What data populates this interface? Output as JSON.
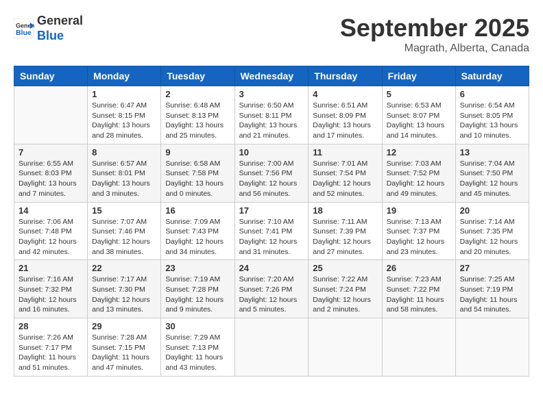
{
  "header": {
    "logo_line1": "General",
    "logo_line2": "Blue",
    "month": "September 2025",
    "location": "Magrath, Alberta, Canada"
  },
  "weekdays": [
    "Sunday",
    "Monday",
    "Tuesday",
    "Wednesday",
    "Thursday",
    "Friday",
    "Saturday"
  ],
  "weeks": [
    [
      {
        "day": "",
        "info": ""
      },
      {
        "day": "1",
        "info": "Sunrise: 6:47 AM\nSunset: 8:15 PM\nDaylight: 13 hours\nand 28 minutes."
      },
      {
        "day": "2",
        "info": "Sunrise: 6:48 AM\nSunset: 8:13 PM\nDaylight: 13 hours\nand 25 minutes."
      },
      {
        "day": "3",
        "info": "Sunrise: 6:50 AM\nSunset: 8:11 PM\nDaylight: 13 hours\nand 21 minutes."
      },
      {
        "day": "4",
        "info": "Sunrise: 6:51 AM\nSunset: 8:09 PM\nDaylight: 13 hours\nand 17 minutes."
      },
      {
        "day": "5",
        "info": "Sunrise: 6:53 AM\nSunset: 8:07 PM\nDaylight: 13 hours\nand 14 minutes."
      },
      {
        "day": "6",
        "info": "Sunrise: 6:54 AM\nSunset: 8:05 PM\nDaylight: 13 hours\nand 10 minutes."
      }
    ],
    [
      {
        "day": "7",
        "info": "Sunrise: 6:55 AM\nSunset: 8:03 PM\nDaylight: 13 hours\nand 7 minutes."
      },
      {
        "day": "8",
        "info": "Sunrise: 6:57 AM\nSunset: 8:01 PM\nDaylight: 13 hours\nand 3 minutes."
      },
      {
        "day": "9",
        "info": "Sunrise: 6:58 AM\nSunset: 7:58 PM\nDaylight: 13 hours\nand 0 minutes."
      },
      {
        "day": "10",
        "info": "Sunrise: 7:00 AM\nSunset: 7:56 PM\nDaylight: 12 hours\nand 56 minutes."
      },
      {
        "day": "11",
        "info": "Sunrise: 7:01 AM\nSunset: 7:54 PM\nDaylight: 12 hours\nand 52 minutes."
      },
      {
        "day": "12",
        "info": "Sunrise: 7:03 AM\nSunset: 7:52 PM\nDaylight: 12 hours\nand 49 minutes."
      },
      {
        "day": "13",
        "info": "Sunrise: 7:04 AM\nSunset: 7:50 PM\nDaylight: 12 hours\nand 45 minutes."
      }
    ],
    [
      {
        "day": "14",
        "info": "Sunrise: 7:06 AM\nSunset: 7:48 PM\nDaylight: 12 hours\nand 42 minutes."
      },
      {
        "day": "15",
        "info": "Sunrise: 7:07 AM\nSunset: 7:46 PM\nDaylight: 12 hours\nand 38 minutes."
      },
      {
        "day": "16",
        "info": "Sunrise: 7:09 AM\nSunset: 7:43 PM\nDaylight: 12 hours\nand 34 minutes."
      },
      {
        "day": "17",
        "info": "Sunrise: 7:10 AM\nSunset: 7:41 PM\nDaylight: 12 hours\nand 31 minutes."
      },
      {
        "day": "18",
        "info": "Sunrise: 7:11 AM\nSunset: 7:39 PM\nDaylight: 12 hours\nand 27 minutes."
      },
      {
        "day": "19",
        "info": "Sunrise: 7:13 AM\nSunset: 7:37 PM\nDaylight: 12 hours\nand 23 minutes."
      },
      {
        "day": "20",
        "info": "Sunrise: 7:14 AM\nSunset: 7:35 PM\nDaylight: 12 hours\nand 20 minutes."
      }
    ],
    [
      {
        "day": "21",
        "info": "Sunrise: 7:16 AM\nSunset: 7:32 PM\nDaylight: 12 hours\nand 16 minutes."
      },
      {
        "day": "22",
        "info": "Sunrise: 7:17 AM\nSunset: 7:30 PM\nDaylight: 12 hours\nand 13 minutes."
      },
      {
        "day": "23",
        "info": "Sunrise: 7:19 AM\nSunset: 7:28 PM\nDaylight: 12 hours\nand 9 minutes."
      },
      {
        "day": "24",
        "info": "Sunrise: 7:20 AM\nSunset: 7:26 PM\nDaylight: 12 hours\nand 5 minutes."
      },
      {
        "day": "25",
        "info": "Sunrise: 7:22 AM\nSunset: 7:24 PM\nDaylight: 12 hours\nand 2 minutes."
      },
      {
        "day": "26",
        "info": "Sunrise: 7:23 AM\nSunset: 7:22 PM\nDaylight: 11 hours\nand 58 minutes."
      },
      {
        "day": "27",
        "info": "Sunrise: 7:25 AM\nSunset: 7:19 PM\nDaylight: 11 hours\nand 54 minutes."
      }
    ],
    [
      {
        "day": "28",
        "info": "Sunrise: 7:26 AM\nSunset: 7:17 PM\nDaylight: 11 hours\nand 51 minutes."
      },
      {
        "day": "29",
        "info": "Sunrise: 7:28 AM\nSunset: 7:15 PM\nDaylight: 11 hours\nand 47 minutes."
      },
      {
        "day": "30",
        "info": "Sunrise: 7:29 AM\nSunset: 7:13 PM\nDaylight: 11 hours\nand 43 minutes."
      },
      {
        "day": "",
        "info": ""
      },
      {
        "day": "",
        "info": ""
      },
      {
        "day": "",
        "info": ""
      },
      {
        "day": "",
        "info": ""
      }
    ]
  ]
}
